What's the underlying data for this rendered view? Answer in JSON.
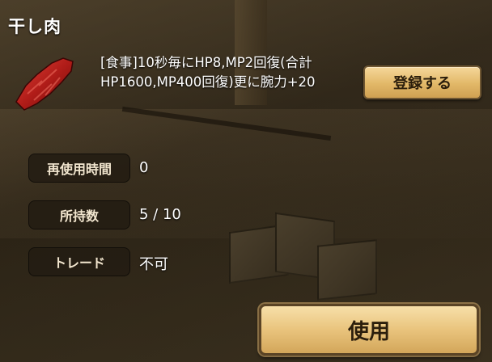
{
  "item": {
    "name": "干し肉",
    "icon": "dried-meat-icon",
    "description": "[食事]10秒毎にHP8,MP2回復(合計HP1600,MP400回復)更に腕力+20"
  },
  "actions": {
    "register_label": "登録する",
    "use_label": "使用"
  },
  "stats": [
    {
      "label": "再使用時間",
      "value": "0"
    },
    {
      "label": "所持数",
      "value": "5 / 10"
    },
    {
      "label": "トレード",
      "value": "不可"
    }
  ],
  "colors": {
    "button_gold": "#e2b868",
    "label_bg": "#231c12",
    "text": "#ffffff"
  }
}
